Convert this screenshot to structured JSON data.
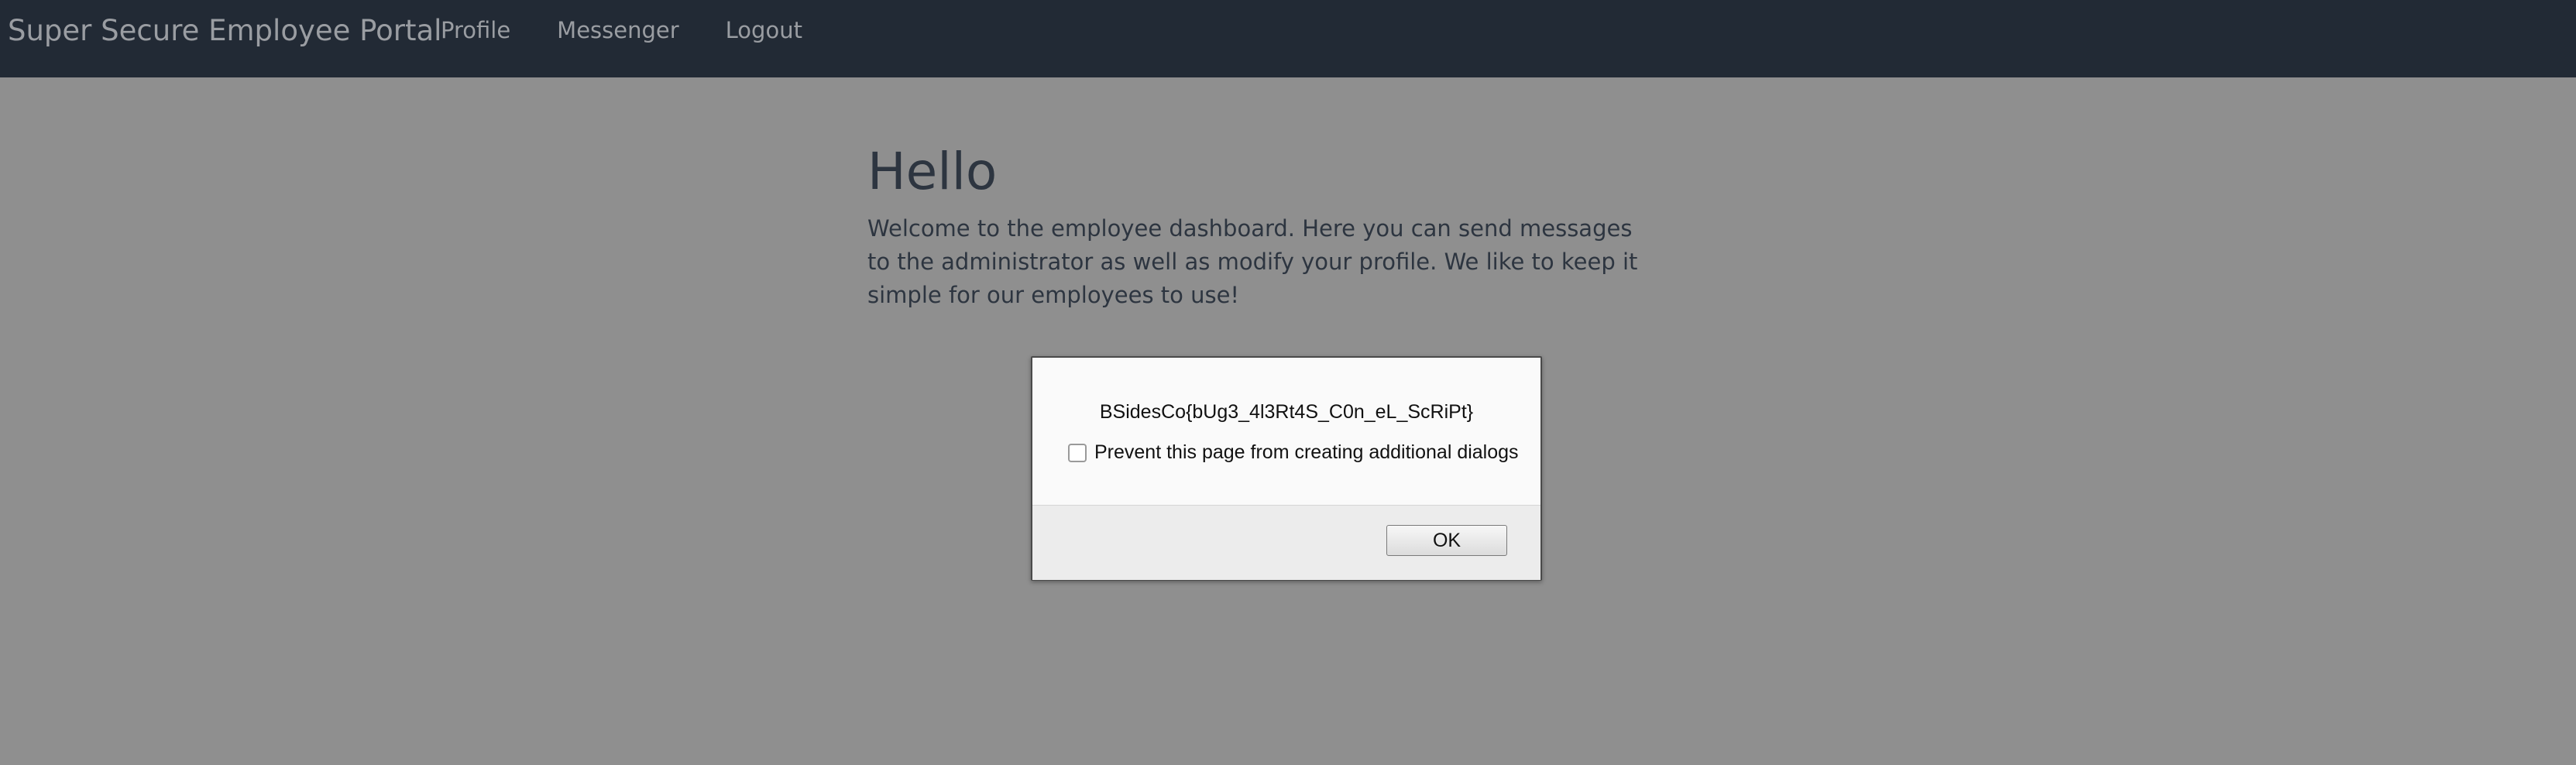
{
  "navbar": {
    "brand": "Super Secure Employee Portal",
    "links": [
      "Profile",
      "Messenger",
      "Logout"
    ]
  },
  "main": {
    "heading": "Hello",
    "paragraph": "Welcome to the employee dashboard. Here you can send messages to the administrator as well as modify your profile. We like to keep it simple for our employees to use!"
  },
  "dialog": {
    "message": "BSidesCo{bUg3_4l3Rt4S_C0n_eL_ScRiPt}",
    "checkbox_label": "Prevent this page from creating additional dialogs",
    "checkbox_checked": false,
    "ok_label": "OK"
  },
  "colors": {
    "navbar_bg": "#222a35",
    "overlay_bg": "#8f8f8f",
    "nav_text": "#9a9da2",
    "body_text": "#2d3540"
  }
}
